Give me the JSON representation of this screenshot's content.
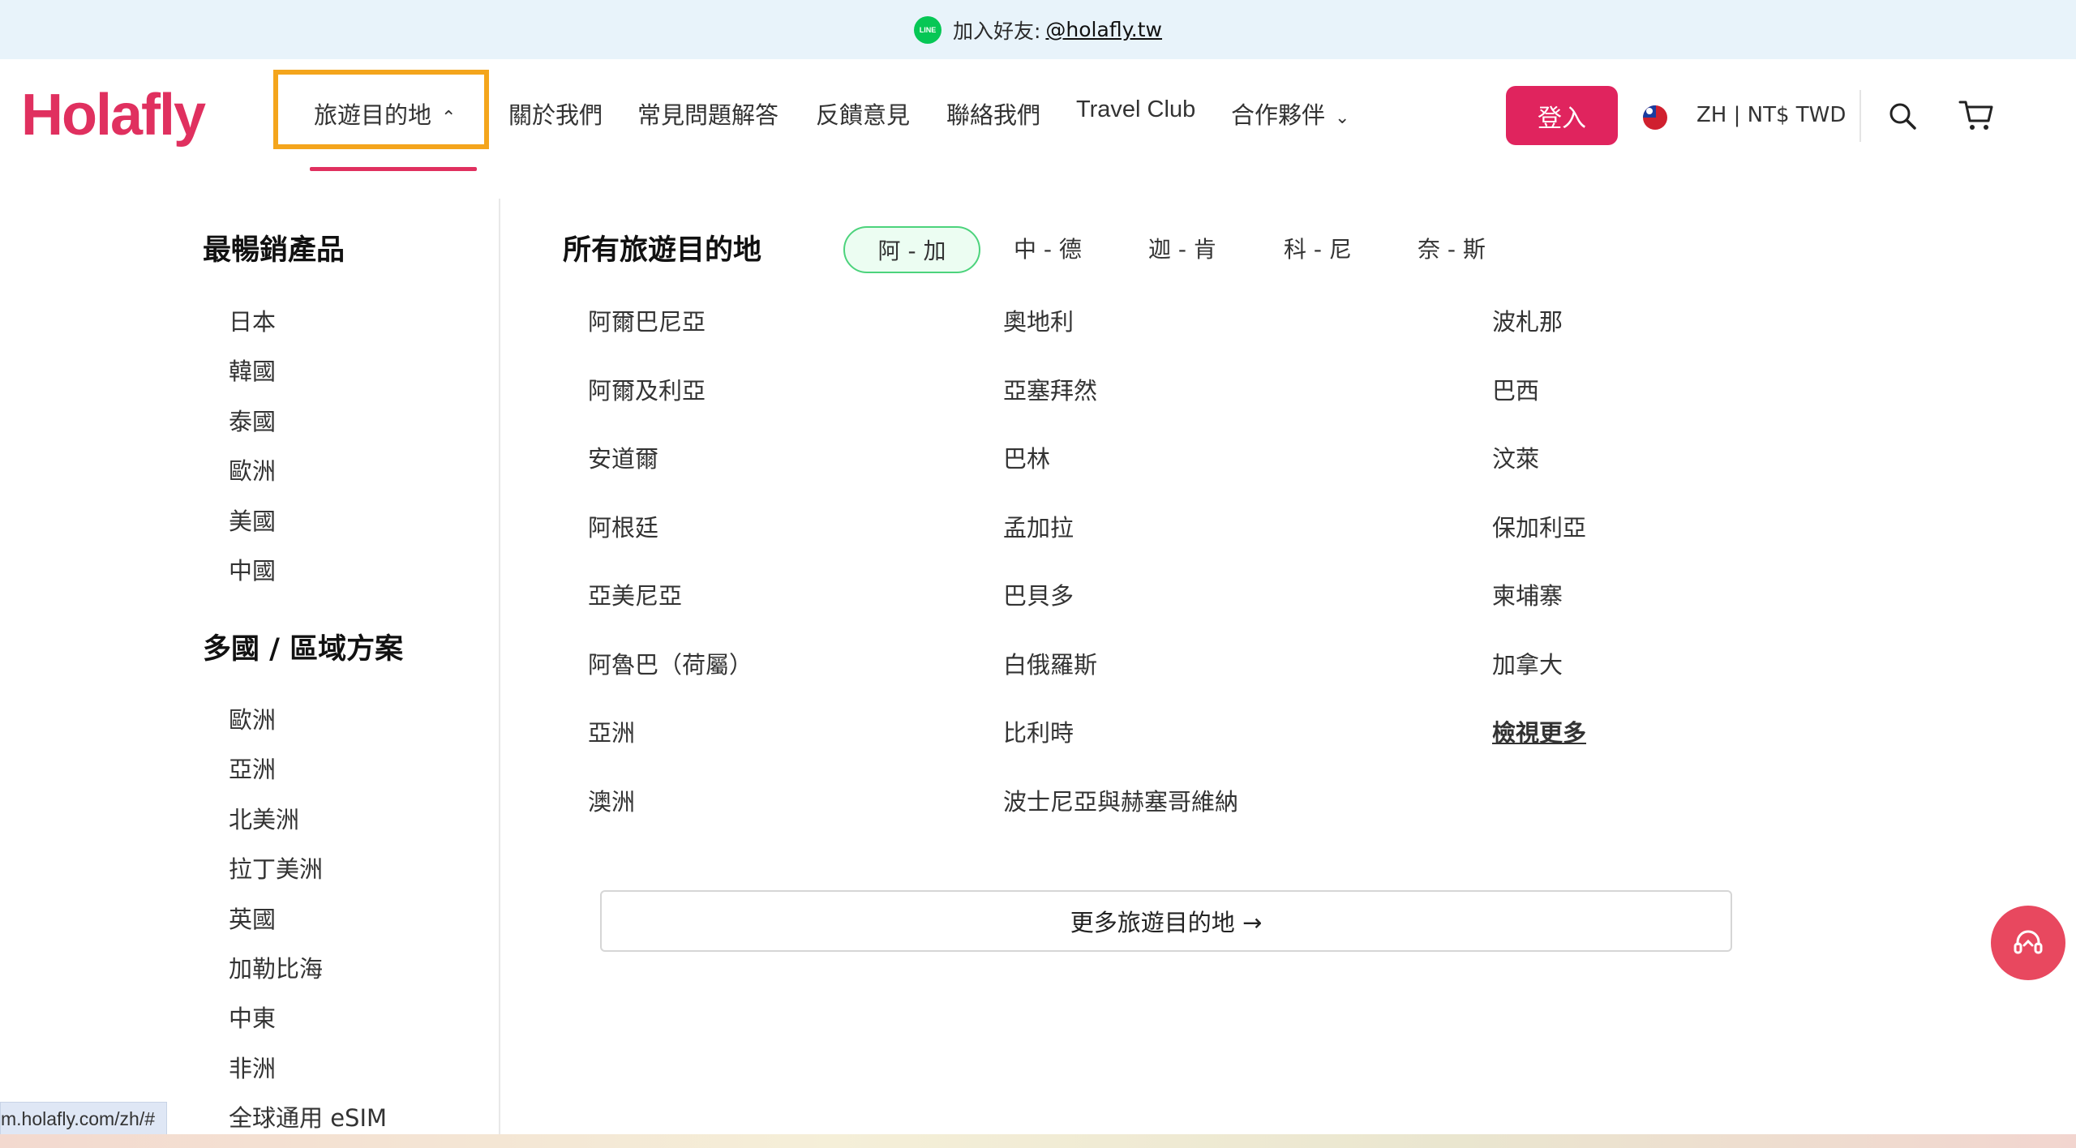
{
  "banner": {
    "text": "加入好友:",
    "handle": "@holafly.tw",
    "icon": "line-icon",
    "icon_text": "LINE"
  },
  "header": {
    "logo": "Holafly",
    "nav": {
      "destinations": "旅遊目的地",
      "about": "關於我們",
      "faq": "常見問題解答",
      "feedback": "反饋意見",
      "contact": "聯絡我們",
      "travel_club": "Travel Club",
      "partners": "合作夥伴"
    },
    "login": "登入",
    "locale": "ZH | NT$ TWD",
    "accent_color": "#e0305f"
  },
  "left": {
    "bestsellers_title": "最暢銷產品",
    "bestsellers": [
      "日本",
      "韓國",
      "泰國",
      "歐洲",
      "美國",
      "中國"
    ],
    "regional_title": "多國 / 區域方案",
    "regional": [
      "歐洲",
      "亞洲",
      "北美洲",
      "拉丁美洲",
      "英國",
      "加勒比海",
      "中東",
      "非洲",
      "全球通用 eSIM"
    ]
  },
  "panel": {
    "title": "所有旅遊目的地",
    "tabs": [
      "阿 - 加",
      "中 - 德",
      "迦 - 肯",
      "科 - 尼",
      "奈 - 斯"
    ],
    "active_tab": "阿 - 加",
    "columns": [
      [
        "阿爾巴尼亞",
        "阿爾及利亞",
        "安道爾",
        "阿根廷",
        "亞美尼亞",
        "阿魯巴（荷屬）",
        "亞洲",
        "澳洲"
      ],
      [
        "奧地利",
        "亞塞拜然",
        "巴林",
        "孟加拉",
        "巴貝多",
        "白俄羅斯",
        "比利時",
        "波士尼亞與赫塞哥維納"
      ],
      [
        "波札那",
        "巴西",
        "汶萊",
        "保加利亞",
        "柬埔寨",
        "加拿大"
      ]
    ],
    "view_more": "檢視更多",
    "more_destinations": "更多旅遊目的地 →"
  },
  "status_url": "m.holafly.com/zh/#"
}
